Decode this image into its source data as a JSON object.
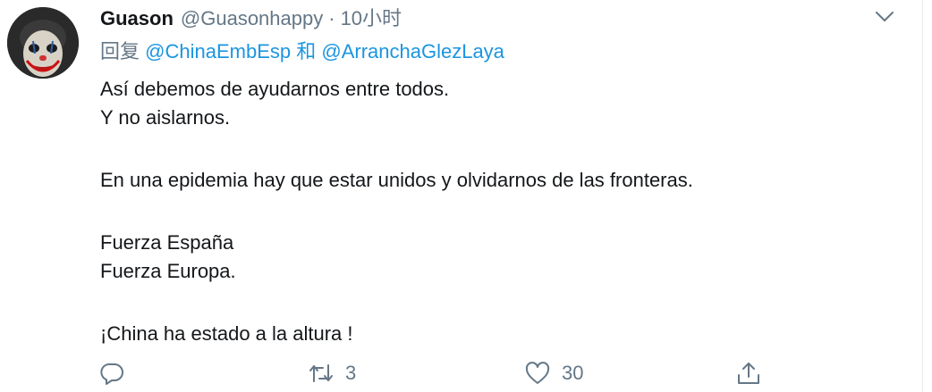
{
  "tweet": {
    "display_name": "Guason",
    "handle": "@Guasonhappy",
    "separator": "·",
    "timestamp": "10小时",
    "reply_prefix": "回复",
    "reply_mention_1": "@ChinaEmbEsp",
    "reply_conjunction": "和",
    "reply_mention_2": "@ArranchaGlezLaya",
    "body_lines": [
      "Así debemos de ayudarnos entre todos.",
      "Y no aislarnos.",
      "En una epidemia hay que estar unidos y olvidarnos de las fronteras.",
      "Fuerza España",
      "Fuerza Europa.",
      "¡China ha estado a la altura !"
    ]
  },
  "actions": {
    "reply_icon": "reply-bubble-icon",
    "retweet_icon": "retweet-icon",
    "retweet_count": "3",
    "like_icon": "heart-icon",
    "like_count": "30",
    "share_icon": "share-icon"
  },
  "colors": {
    "text_primary": "#14171a",
    "text_secondary": "#657786",
    "link": "#1b95e0"
  }
}
